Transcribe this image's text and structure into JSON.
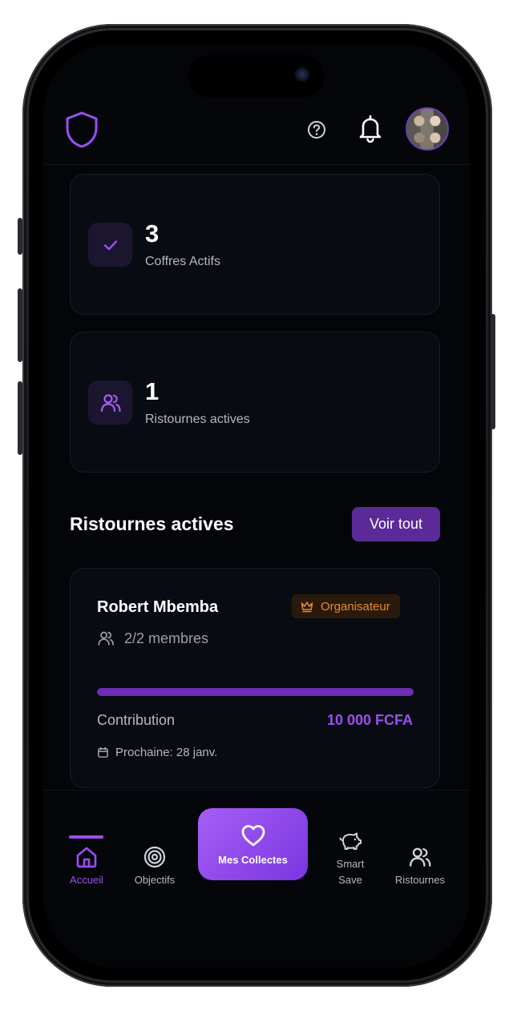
{
  "header": {
    "logo_icon": "shield-icon",
    "help_icon": "help-circle-icon",
    "notifications_icon": "bell-icon",
    "avatar_icon": "avatar"
  },
  "stats": [
    {
      "value": "3",
      "label": "Coffres Actifs",
      "icon": "check-icon"
    },
    {
      "value": "1",
      "label": "Ristournes actives",
      "icon": "users-icon"
    }
  ],
  "section": {
    "title": "Ristournes actives",
    "see_all_label": "Voir tout"
  },
  "tontine_card": {
    "name": "Robert Mbemba",
    "role_badge": "Organisateur",
    "role_icon": "crown-icon",
    "members": "2/2 membres",
    "progress": 1.0,
    "contribution_label": "Contribution",
    "contribution_amount": "10 000 FCFA",
    "next_label": "Prochaine: 28 janv."
  },
  "bottom_nav": {
    "items": [
      {
        "label": "Accueil",
        "icon": "home-icon",
        "active": true
      },
      {
        "label": "Objectifs",
        "icon": "target-icon",
        "active": false
      },
      {
        "label": "Mes Collectes",
        "icon": "heart-icon",
        "active": false
      },
      {
        "label": "Smart Save",
        "icon": "piggy-bank-icon",
        "active": false
      },
      {
        "label": "Ristournes",
        "icon": "users-icon",
        "active": false
      }
    ]
  },
  "colors": {
    "accent": "#9a4ff0",
    "accent_dark": "#5b2a98",
    "badge_orange": "#e58a2e",
    "background": "#040509",
    "card": "#090b12"
  }
}
